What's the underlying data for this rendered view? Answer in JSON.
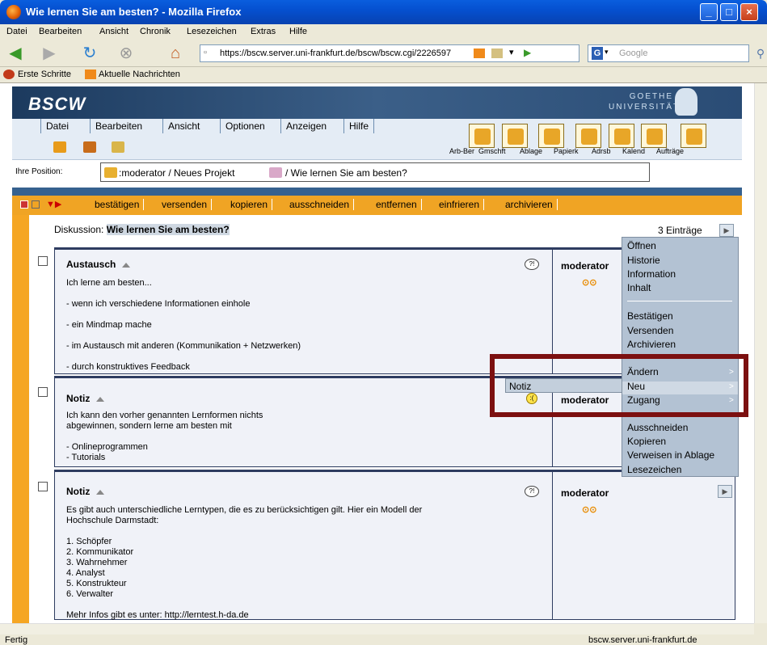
{
  "window": {
    "title": "Wie lernen Sie am besten? - Mozilla Firefox",
    "minimize": "_",
    "maximize": "□",
    "close": "×"
  },
  "browser_menu": [
    "Datei",
    "Bearbeiten",
    "Ansicht",
    "Chronik",
    "Lesezeichen",
    "Extras",
    "Hilfe"
  ],
  "url": "https://bscw.server.uni-frankfurt.de/bscw/bscw.cgi/2226597",
  "search_placeholder": "Google",
  "bookmarks": [
    "Erste Schritte",
    "Aktuelle Nachrichten"
  ],
  "bscw": {
    "logo": "BSCW",
    "university_line1": "GOETHE",
    "university_line2": "UNIVERSITÄT",
    "menu": [
      "Datei",
      "Bearbeiten",
      "Ansicht",
      "Optionen",
      "Anzeigen",
      "Hilfe"
    ],
    "toolbar": [
      "Arb-Ber",
      "Gmschft",
      "Ablage",
      "Papierk",
      "Adrsb",
      "Kalend",
      "Aufträge"
    ],
    "position_label": "Ihre Position:",
    "position_path1": ":moderator / Neues Projekt",
    "position_path2": "/ Wie lernen Sie am besten?",
    "actions": [
      "bestätigen",
      "versenden",
      "kopieren",
      "ausschneiden",
      "entfernen",
      "einfrieren",
      "archivieren"
    ],
    "discussion_label": "Diskussion:",
    "discussion_title": "Wie lernen Sie am besten?",
    "entries_count": "3 Einträge"
  },
  "entries": [
    {
      "title": "Austausch",
      "author": "moderator",
      "glasses": "⊙⊙",
      "text": "Ich lerne am besten...\n\n- wenn ich verschiedene Informationen einhole\n\n- ein Mindmap mache\n\n- im Austausch mit anderen (Kommunikation + Netzwerken)\n\n- durch konstruktives Feedback"
    },
    {
      "title": "Notiz",
      "author": "moderator",
      "text": "Ich kann den vorher genannten Lernformen nichts\nabgewinnen, sondern lerne am besten mit\n\n- Onlineprogrammen\n- Tutorials"
    },
    {
      "title": "Notiz",
      "author": "moderator",
      "glasses": "⊙⊙",
      "text": "Es gibt auch unterschiedliche Lerntypen, die es zu berücksichtigen gilt. Hier ein Modell der\nHochschule Darmstadt:\n\n1. Schöpfer\n2. Kommunikator\n3. Wahrnehmer\n4. Analyst\n5. Konstrukteur\n6. Verwalter\n\nMehr Infos gibt es unter: http://lerntest.h-da.de"
    }
  ],
  "context_menu": [
    "Öffnen",
    "Historie",
    "Information",
    "Inhalt",
    "Bestätigen",
    "Versenden",
    "Archivieren",
    "Ändern",
    "Neu",
    "Zugang",
    "Ausschneiden",
    "Kopieren",
    "Verweisen in Ablage",
    "Lesezeichen"
  ],
  "submenu_item": "Notiz",
  "status": {
    "left": "Fertig",
    "right": "bscw.server.uni-frankfurt.de"
  }
}
